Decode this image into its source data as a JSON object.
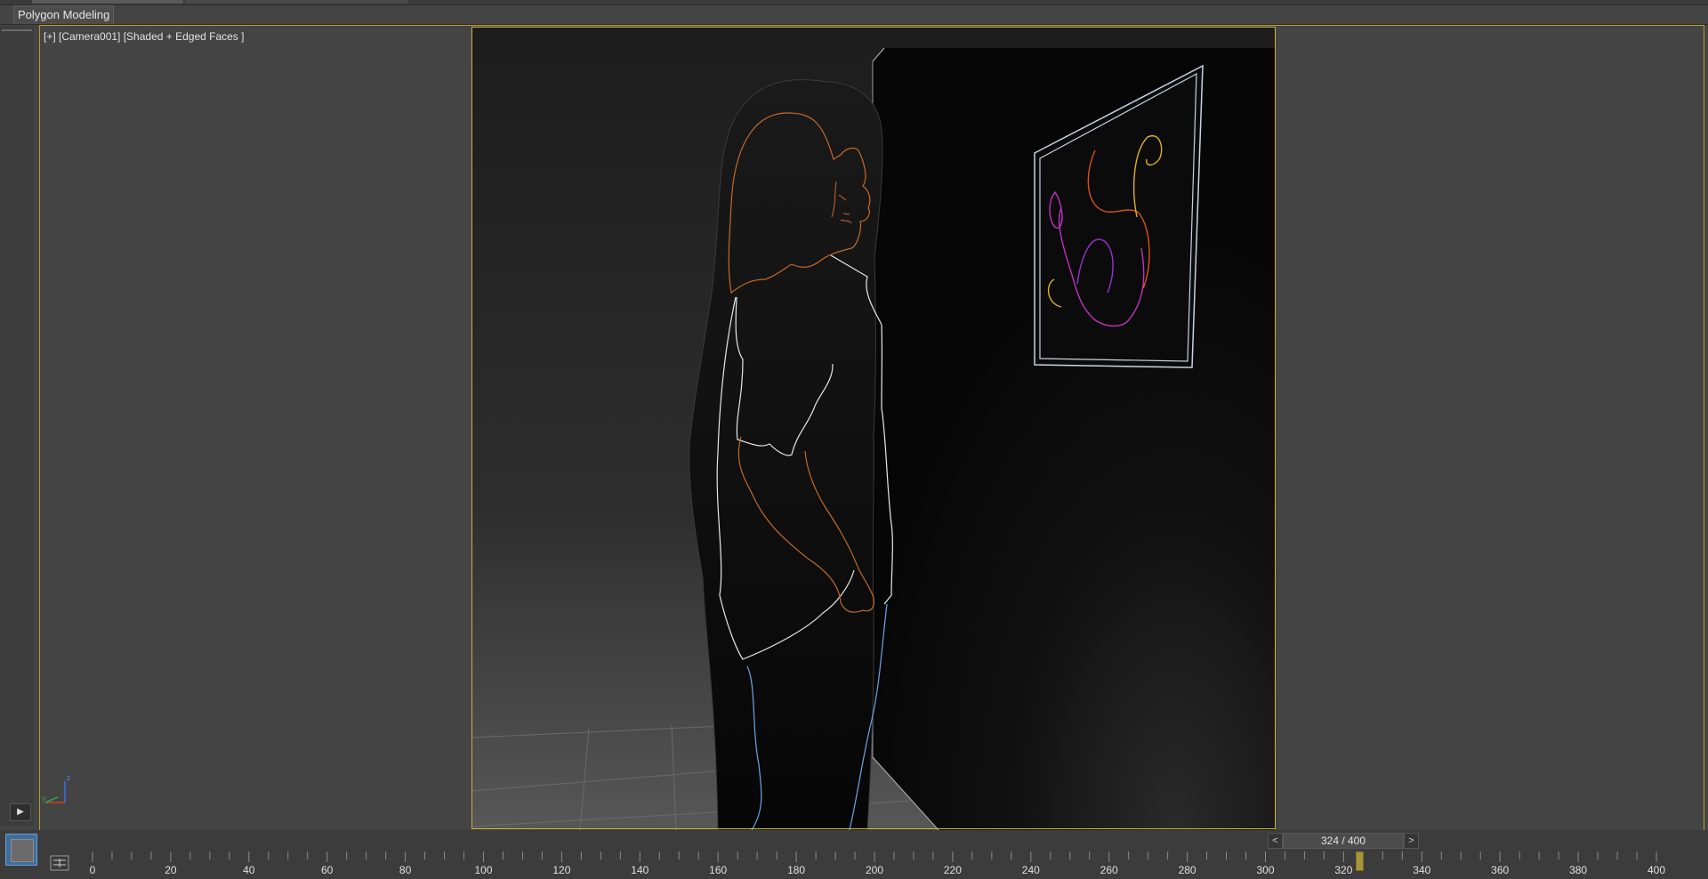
{
  "ribbon": {
    "active_tab": "Polygon Modeling"
  },
  "viewport": {
    "label": "[+] [Camera001] [Shaded + Edged Faces ]",
    "axis_labels": {
      "x": "x",
      "y": "y",
      "z": "z"
    }
  },
  "scene_description_colors": {
    "frame_highlight": "#c9b33a",
    "viewport_border": "#b59f2b",
    "outline_orange": "#c46a2a",
    "outline_white": "#e8e8e8",
    "outline_blue": "#6fa6e6",
    "art_magenta": "#c030c0",
    "art_orange": "#d9531c",
    "art_yellow": "#e0b21a"
  },
  "timeslider": {
    "prev": "<",
    "value": "324 / 400",
    "next": ">"
  },
  "play_button": {
    "icon": "play-icon"
  },
  "timeline": {
    "ticks": [
      "0",
      "20",
      "40",
      "60",
      "80",
      "100",
      "120",
      "140",
      "160",
      "180",
      "200",
      "220",
      "240",
      "260",
      "280",
      "300",
      "320",
      "340",
      "360",
      "380",
      "400"
    ],
    "current_frame": 324,
    "total_frames": 400
  }
}
